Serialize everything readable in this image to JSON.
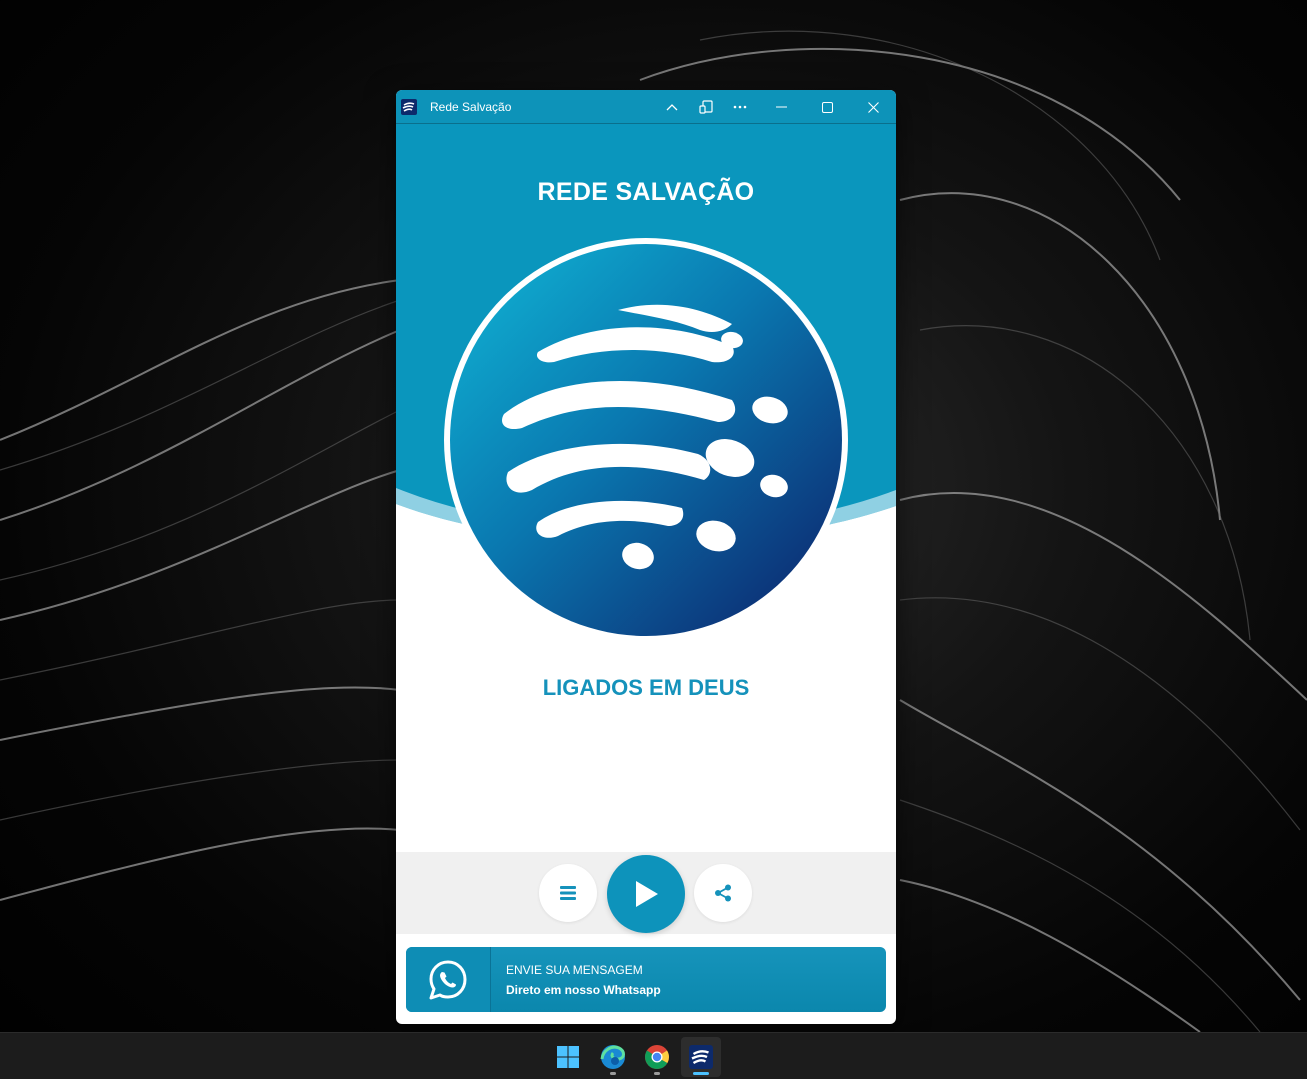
{
  "window": {
    "title": "Rede Salvação",
    "controls": [
      "chevron-up-icon",
      "cast-icon",
      "more-icon",
      "minimize-icon",
      "maximize-icon",
      "close-icon"
    ]
  },
  "app": {
    "heading": "REDE SALVAÇÃO",
    "slogan": "LIGADOS EM DEUS",
    "player": {
      "menu_icon": "menu-icon",
      "play_icon": "play-icon",
      "share_icon": "share-icon"
    },
    "whatsapp": {
      "line1": "ENVIE SUA MENSAGEM",
      "line2": "Direto em nosso Whatsapp"
    }
  },
  "taskbar": {
    "apps": [
      "windows-start-icon",
      "edge-icon",
      "chrome-icon",
      "rede-salvacao-icon"
    ],
    "active": "rede-salvacao-icon"
  },
  "colors": {
    "brand": "#0a96bd",
    "brand_dark": "#0d2a6b",
    "slogan": "#1592bb",
    "player_bar": "#f0f0f0"
  }
}
